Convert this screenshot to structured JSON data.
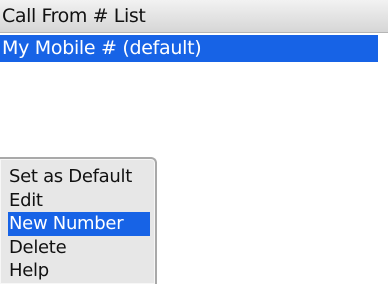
{
  "header": {
    "title": "Call From # List"
  },
  "list": {
    "items": [
      {
        "label": "My Mobile # (default)",
        "selected": true
      }
    ]
  },
  "menu": {
    "items": [
      {
        "label": "Set as Default"
      },
      {
        "label": "Edit"
      },
      {
        "label": "New Number",
        "highlighted": true
      },
      {
        "label": "Delete"
      },
      {
        "label": "Help"
      }
    ]
  },
  "colors": {
    "selection": "#1763e6",
    "menu_bg": "#e7e7e7"
  }
}
